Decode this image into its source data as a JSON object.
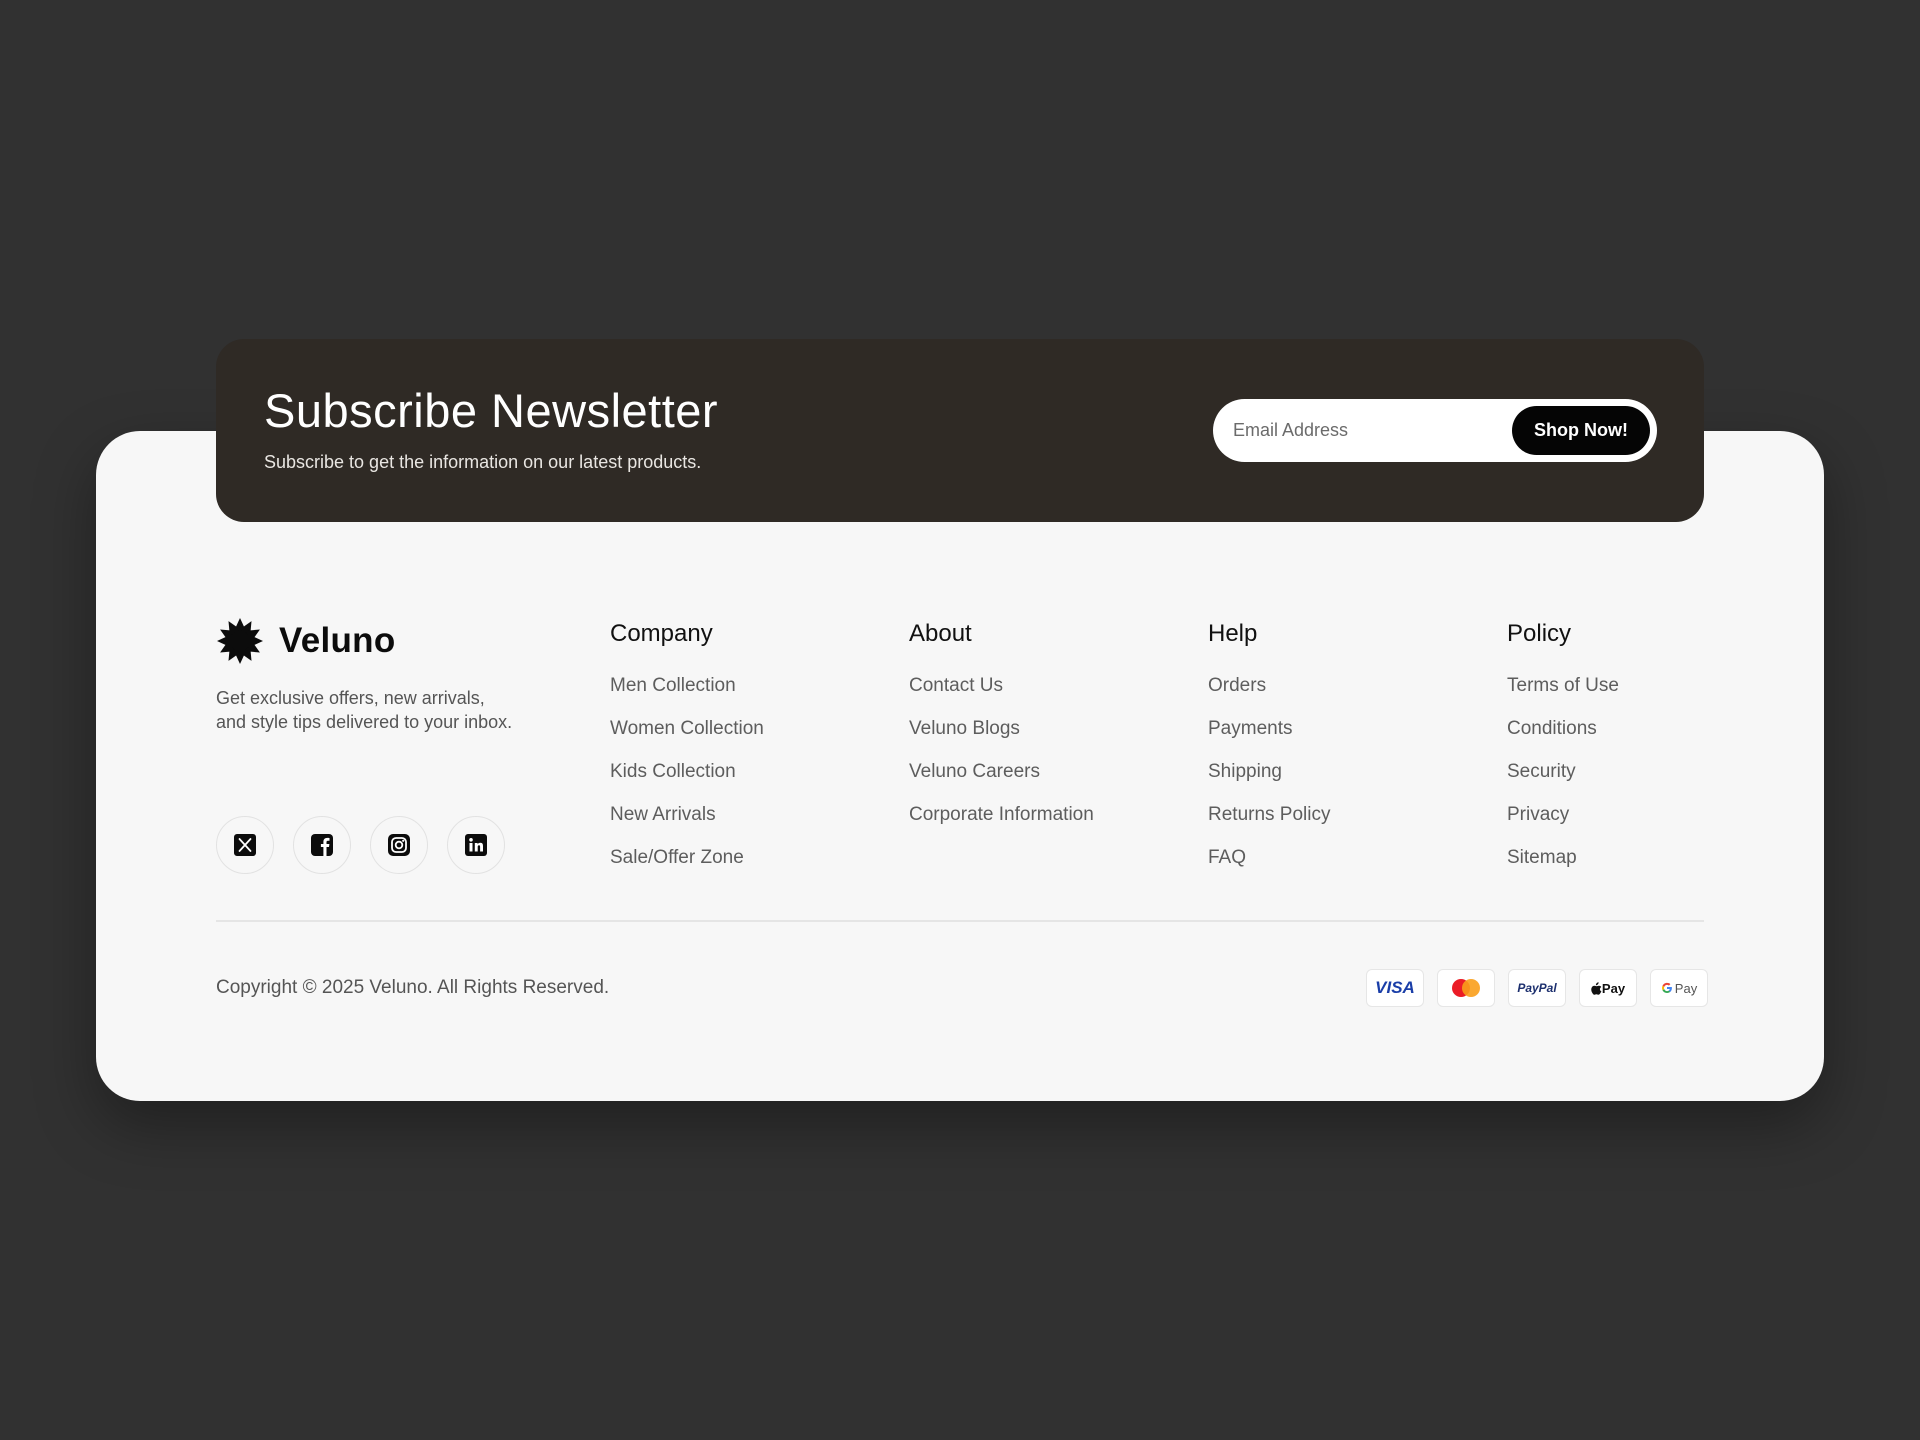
{
  "newsletter": {
    "title": "Subscribe Newsletter",
    "subtitle": "Subscribe to get the information on our latest products.",
    "email_placeholder": "Email Address",
    "button_label": "Shop Now!"
  },
  "brand": {
    "name": "Veluno",
    "description": "Get exclusive offers, new arrivals, and style tips delivered to your inbox.",
    "logo_icon": "sunburst-logo-icon"
  },
  "socials": [
    {
      "name": "x",
      "icon": "x-twitter-icon"
    },
    {
      "name": "facebook",
      "icon": "facebook-icon"
    },
    {
      "name": "instagram",
      "icon": "instagram-icon"
    },
    {
      "name": "linkedin",
      "icon": "linkedin-icon"
    }
  ],
  "columns": [
    {
      "title": "Company",
      "links": [
        "Men Collection",
        "Women Collection",
        "Kids Collection",
        "New Arrivals",
        "Sale/Offer Zone"
      ]
    },
    {
      "title": "About",
      "links": [
        "Contact Us",
        "Veluno Blogs",
        "Veluno Careers",
        "Corporate Information"
      ]
    },
    {
      "title": "Help",
      "links": [
        "Orders",
        "Payments",
        "Shipping",
        "Returns Policy",
        "FAQ"
      ]
    },
    {
      "title": "Policy",
      "links": [
        "Terms of Use",
        "Conditions",
        "Security",
        "Privacy",
        "Sitemap"
      ]
    }
  ],
  "copyright": "Copyright © 2025 Veluno. All Rights Reserved.",
  "payments": {
    "visa": "VISA",
    "mastercard_icon": "mastercard-icon",
    "paypal": "PayPal",
    "apple_pay": "Pay",
    "google_pay": "Pay"
  },
  "colors": {
    "page_background": "#313131",
    "card_background": "#f7f7f7",
    "newsletter_background": "#2f2a25",
    "button_background": "#050505"
  }
}
